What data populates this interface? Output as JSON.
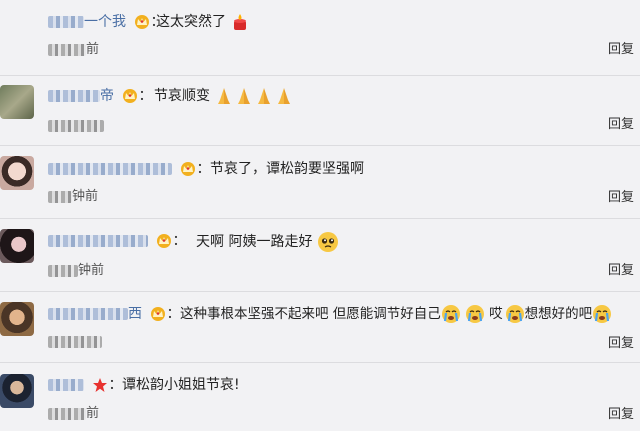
{
  "comments": [
    {
      "name_visible": "一个我",
      "colon": "：",
      "text": "这太突然了",
      "time_visible": "前",
      "reply": "回复"
    },
    {
      "name_visible": "帝",
      "colon": "：",
      "text": "节哀顺变",
      "time_visible": "",
      "reply": "回复"
    },
    {
      "name_visible": "",
      "colon": "：",
      "text": "节哀了，谭松韵要坚强啊",
      "time_visible": "钟前",
      "reply": "回复"
    },
    {
      "name_visible": "",
      "colon": "：",
      "text": "天啊 阿姨一路走好",
      "time_visible": "钟前",
      "reply": "回复"
    },
    {
      "name_visible": "西",
      "colon": "：",
      "text_a": "这种事根本坚强不起来吧 但愿能调节好自己",
      "text_b": "哎",
      "text_c": "想想好的吧",
      "time_visible": "",
      "reply": "回复"
    },
    {
      "name_visible": "",
      "colon": "：",
      "text": "谭松韵小姐姐节哀!",
      "time_visible": "前",
      "reply": "回复"
    }
  ],
  "colors": {
    "background": "#f2f2f4",
    "name": "#4a6fa5",
    "divider": "#dcdcdf",
    "crown": "#f2b01e"
  },
  "icons": {
    "vip_badge": "crown-badge-icon",
    "star_badge": "star-badge-icon",
    "candle": "candle-emoji-icon",
    "pray": "pray-hands-emoji-icon",
    "pleading": "pleading-face-emoji-icon",
    "crying": "crying-face-emoji-icon"
  }
}
